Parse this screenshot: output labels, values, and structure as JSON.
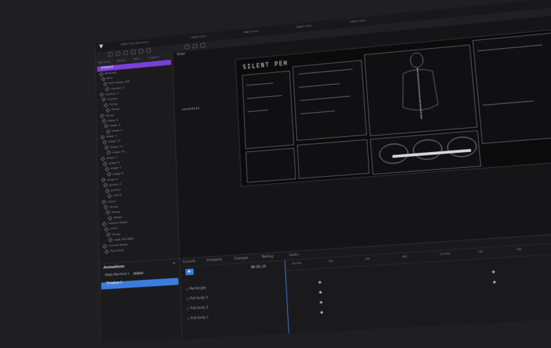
{
  "window": {
    "tabs": [
      "SPACE HUD",
      "SPACE HUD",
      "SPACE HUD",
      "SPACE HUD",
      "SPACE HUD"
    ],
    "app_title": "SPACE HUD Animation"
  },
  "left_panel": {
    "tabs": [
      "Hierarchy",
      "Assets",
      "Files",
      "Inspect"
    ],
    "selected_item": "Artboard",
    "tree": [
      "Artboard",
      "Rect",
      "Path shape_002",
      "Outliner 3",
      "Outliner 2",
      "Outliner",
      "Group",
      "Group",
      "Group",
      "shape 4",
      "shape 3",
      "shape 2",
      "shape 1",
      "shape 12",
      "shape 11",
      "shape 10",
      "shape 9",
      "shape 8",
      "shape 7",
      "shape 6",
      "shape 5",
      "pointer 2",
      "pointer",
      "vital 3",
      "vital 2",
      "Group",
      "Group",
      "Shape",
      "Custom Shape",
      "vital 1",
      "Group",
      "rigid_0213445",
      "Custom Shape",
      "Text block"
    ]
  },
  "stage": {
    "label": "Stage",
    "hud_title": "SILENT PEH"
  },
  "animations": {
    "title": "Animations",
    "add_label": "+",
    "state_machine": "State Machine 1",
    "state_badge": "Default",
    "timeline": "Timeline 1"
  },
  "bottom": {
    "tabs": [
      "Console",
      "Problems",
      "Changes",
      "Testing",
      "Audio"
    ],
    "timecode": "00:01:15",
    "ruler": [
      "00:00s",
      "10f",
      "20f",
      "40f",
      "01:00s",
      "10f",
      "30f",
      "40f",
      "02:00s"
    ],
    "tracks": [
      "Rectangle",
      "Full body 3",
      "Full body 2",
      "Full body 1"
    ]
  },
  "colors": {
    "accent_purple": "#7c3fd6",
    "accent_blue": "#3b7ddd",
    "bg": "#1f1f22"
  }
}
